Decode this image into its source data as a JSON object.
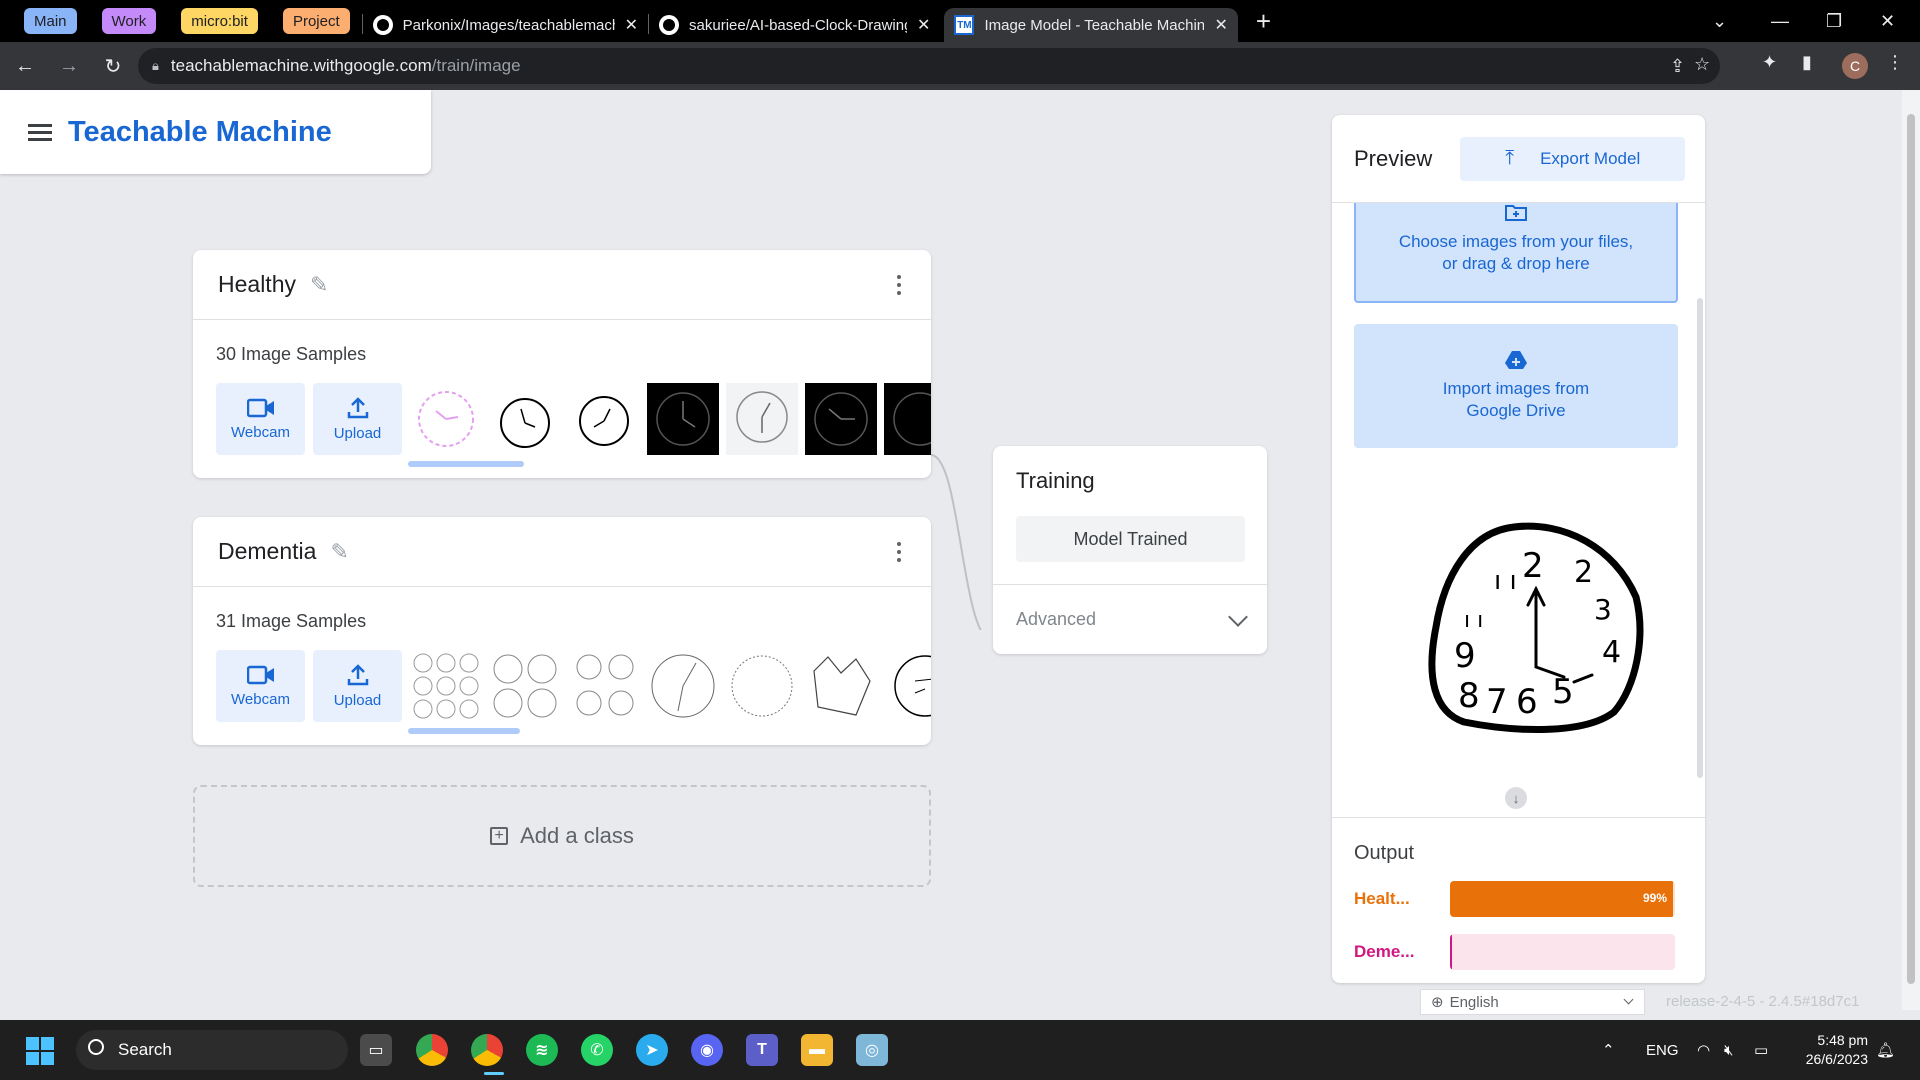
{
  "browser": {
    "tab_groups": [
      {
        "label": "Main",
        "color": "#8ab4f8"
      },
      {
        "label": "Work",
        "color": "#c58af9"
      },
      {
        "label": "micro:bit",
        "color": "#fdd663"
      },
      {
        "label": "Project",
        "color": "#fcad70"
      }
    ],
    "tabs": [
      {
        "title": "Parkonix/Images/teachablemachi",
        "icon": "github-icon",
        "active": false
      },
      {
        "title": "sakuriee/AI-based-Clock-Drawing",
        "icon": "github-icon",
        "active": false
      },
      {
        "title": "Image Model - Teachable Machin",
        "icon": "teachable-machine-icon",
        "favicon_text": "TM",
        "active": true
      }
    ],
    "url_host": "teachablemachine.withgoogle.com",
    "url_path": "/train/image",
    "profile_initial": "C"
  },
  "app": {
    "brand": "Teachable Machine"
  },
  "classes": [
    {
      "name": "Healthy",
      "samples": "30 Image Samples",
      "webcam_label": "Webcam",
      "upload_label": "Upload"
    },
    {
      "name": "Dementia",
      "samples": "31 Image Samples",
      "webcam_label": "Webcam",
      "upload_label": "Upload"
    }
  ],
  "add_class_label": "Add a class",
  "training": {
    "title": "Training",
    "button_label": "Model Trained",
    "advanced_label": "Advanced"
  },
  "preview": {
    "title": "Preview",
    "export_label": "Export Model",
    "drop_line1": "Choose images from your files,",
    "drop_line2": "or drag & drop here",
    "drive_line1": "Import images from",
    "drive_line2": "Google Drive",
    "output_title": "Output",
    "outputs": [
      {
        "label": "Healt...",
        "percent_text": "99%",
        "value": 0.99,
        "color": "#e8710a",
        "track": "#fde3cf"
      },
      {
        "label": "Deme...",
        "percent_text": "",
        "value": 0.01,
        "color": "#d01884",
        "track": "#fce4ec"
      }
    ]
  },
  "footer": {
    "language": "English",
    "release": "release-2-4-5 - 2.4.5#18d7c1"
  },
  "taskbar": {
    "search_label": "Search",
    "lang": "ENG",
    "time": "5:48 pm",
    "date": "26/6/2023"
  }
}
